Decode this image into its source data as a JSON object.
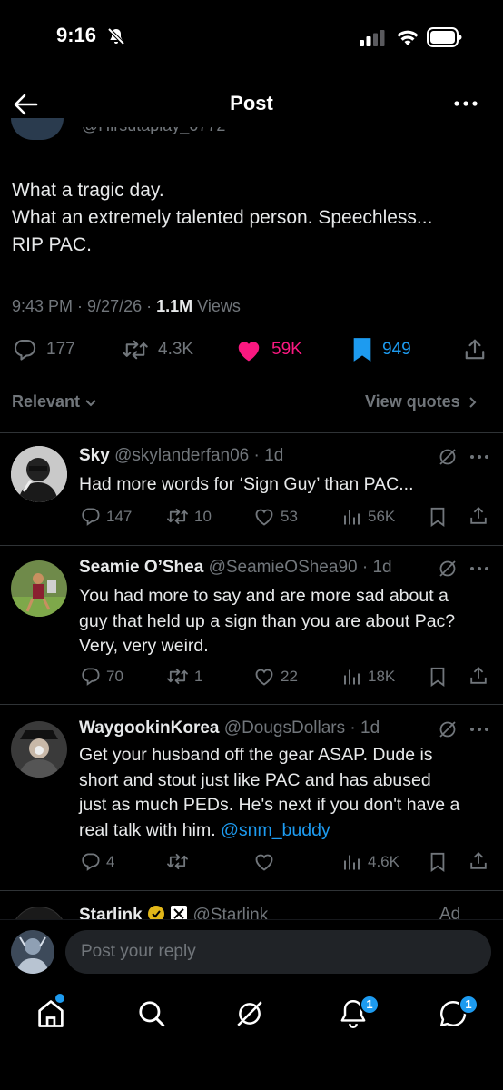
{
  "status_bar": {
    "time": "9:16"
  },
  "header": {
    "title": "Post",
    "cutoff_handle": "@Hirsutaplay_0772"
  },
  "tweet": {
    "lines": [
      "What a tragic day.",
      "What an extremely talented person. Speechless...",
      "RIP PAC."
    ],
    "time": "9:43 PM",
    "date": "9/27/26",
    "views_count": "1.1M",
    "views_label": "Views",
    "replies": "177",
    "reposts": "4.3K",
    "likes": "59K",
    "bookmarks": "949"
  },
  "sort": {
    "label": "Relevant",
    "view_quotes": "View quotes"
  },
  "replies": [
    {
      "name": "Sky",
      "handle": "@skylanderfan06",
      "age": "1d",
      "lines": [
        "Had more words for ‘Sign Guy’ than PAC..."
      ],
      "replies": "147",
      "reposts": "10",
      "likes": "53",
      "views": "56K"
    },
    {
      "name": "Seamie O’Shea",
      "handle": "@SeamieOShea90",
      "age": "1d",
      "lines": [
        "You had more to say and are more sad about a",
        "guy that held up a sign than you are about Pac?",
        "Very, very weird."
      ],
      "replies": "70",
      "reposts": "1",
      "likes": "22",
      "views": "18K"
    },
    {
      "name": "WaygookinKorea",
      "handle": "@DougsDollars",
      "age": "1d",
      "lines": [
        "Get your husband off the gear ASAP. Dude is",
        "short and stout just like PAC and has abused",
        "just as much PEDs. He's next if you don't have a",
        "real talk with him."
      ],
      "mention": "@snm_buddy",
      "replies": "4",
      "reposts": "",
      "likes": "",
      "views": "4.6K"
    }
  ],
  "ad": {
    "name": "Starlink",
    "handle": "@Starlink",
    "label": "Ad"
  },
  "reply_bar": {
    "placeholder": "Post your reply"
  },
  "nav": {
    "notifications_badge": "1",
    "messages_badge": "1"
  },
  "colors": {
    "accent": "#1d9bf0",
    "like": "#f91880",
    "muted": "#71767b",
    "text": "#e7e9ea"
  }
}
